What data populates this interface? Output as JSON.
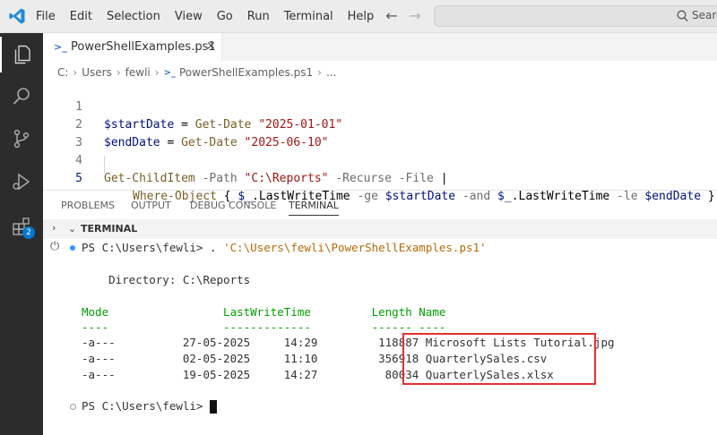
{
  "menu": [
    "File",
    "Edit",
    "Selection",
    "View",
    "Go",
    "Run",
    "Terminal",
    "Help"
  ],
  "search": {
    "placeholder": "Search"
  },
  "tab": {
    "title": "PowerShellExamples.ps1",
    "close": "×"
  },
  "breadcrumb": {
    "items": [
      "C:",
      "Users",
      "fewli",
      "PowerShellExamples.ps1",
      "..."
    ]
  },
  "editor": {
    "lines": [
      {
        "num": "1",
        "var": "$startDate",
        "eq": " = ",
        "cmd": "Get-Date",
        "str": " \"2025-01-01\""
      },
      {
        "num": "2",
        "var": "$endDate",
        "eq": " = ",
        "cmd": "Get-Date",
        "str": " \"2025-06-10\""
      },
      {
        "num": "3"
      },
      {
        "num": "4",
        "cmd": "Get-ChildItem",
        "p1": " -Path ",
        "s1": "\"C:\\Reports\"",
        "p2": " -Recurse -File",
        "pipe": " |"
      },
      {
        "num": "5",
        "cmd": "Where-Object",
        "b1": " { ",
        "v1": "$_",
        "m1": ".LastWriteTime",
        "p1": " -ge ",
        "v2": "$startDate",
        "p2": " -and ",
        "v3": "$_",
        "m2": ".LastWriteTime",
        "p3": " -le ",
        "v4": "$endDate",
        "b2": " }"
      }
    ]
  },
  "panel": {
    "tabs": [
      "PROBLEMS",
      "OUTPUT",
      "DEBUG CONSOLE",
      "TERMINAL"
    ],
    "section_title": "TERMINAL"
  },
  "terminal": {
    "cmd_prompt": "PS C:\\Users\\fewli> ",
    "cmd_text": ". ",
    "cmd_path": "'C:\\Users\\fewli\\PowerShellExamples.ps1'",
    "directory": "    Directory: C:\\Reports",
    "header": "Mode                 LastWriteTime         Length Name",
    "underline": "----                 -------------         ------ ----",
    "rows": [
      "-a---          27-05-2025     14:29         118887 Microsoft Lists Tutorial.jpg",
      "-a---          02-05-2025     11:10         356918 QuarterlySales.csv",
      "-a---          19-05-2025     14:27          80034 QuarterlySales.xlsx"
    ],
    "final_prompt": "PS C:\\Users\\fewli> "
  },
  "colors": {
    "accent": "#0078d4",
    "highlight": "#e63030",
    "terminal_header": "#00a000"
  },
  "icons": [
    "vscode-logo-icon",
    "explorer-icon",
    "search-icon",
    "source-control-icon",
    "run-debug-icon",
    "extensions-icon",
    "powershell-file-icon",
    "terminal-plug-icon"
  ]
}
